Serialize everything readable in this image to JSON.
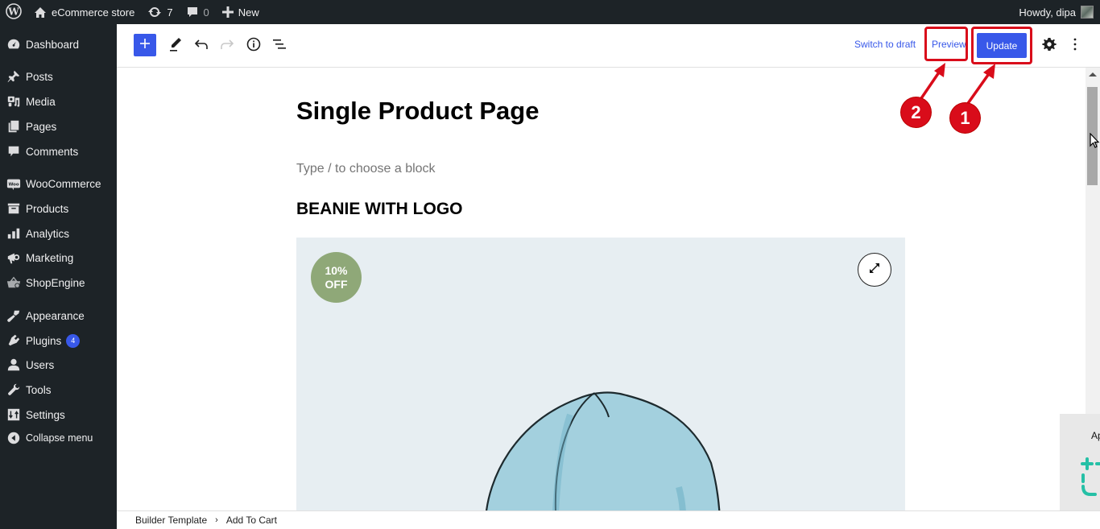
{
  "admin_bar": {
    "site_name": "eCommerce store",
    "updates_count": "7",
    "comments_count": "0",
    "new_label": "New",
    "greeting": "Howdy, dipa"
  },
  "sidebar": {
    "items": [
      {
        "label": "Dashboard",
        "icon": "dashboard-icon"
      },
      {
        "label": "Posts",
        "icon": "pin-icon"
      },
      {
        "label": "Media",
        "icon": "media-icon"
      },
      {
        "label": "Pages",
        "icon": "pages-icon"
      },
      {
        "label": "Comments",
        "icon": "comment-icon"
      },
      {
        "label": "WooCommerce",
        "icon": "woo-icon"
      },
      {
        "label": "Products",
        "icon": "archive-icon"
      },
      {
        "label": "Analytics",
        "icon": "bar-chart-icon"
      },
      {
        "label": "Marketing",
        "icon": "megaphone-icon"
      },
      {
        "label": "ShopEngine",
        "icon": "basket-icon"
      },
      {
        "label": "Appearance",
        "icon": "paintbrush-icon"
      },
      {
        "label": "Plugins",
        "icon": "plug-icon",
        "badge": "4"
      },
      {
        "label": "Users",
        "icon": "user-icon"
      },
      {
        "label": "Tools",
        "icon": "wrench-icon"
      },
      {
        "label": "Settings",
        "icon": "settings-icon"
      },
      {
        "label": "Collapse menu",
        "icon": "collapse-icon"
      }
    ]
  },
  "toolbar": {
    "switch_to_draft": "Switch to draft",
    "preview": "Preview",
    "update": "Update"
  },
  "editor": {
    "post_title": "Single Product Page",
    "block_placeholder": "Type / to choose a block",
    "product_title": "BEANIE WITH LOGO",
    "sale_badge_line1": "10%",
    "sale_badge_line2": "OFF"
  },
  "breadcrumb": {
    "items": [
      "Builder Template",
      "Add To Cart"
    ]
  },
  "floating_panel": {
    "label": "Ap"
  },
  "annotations": {
    "step1": "1",
    "step2": "2"
  },
  "colors": {
    "accent": "#3858e9",
    "admin_bg": "#1d2327",
    "annotation_red": "#d90c1a",
    "sale_badge": "#8fa878"
  }
}
